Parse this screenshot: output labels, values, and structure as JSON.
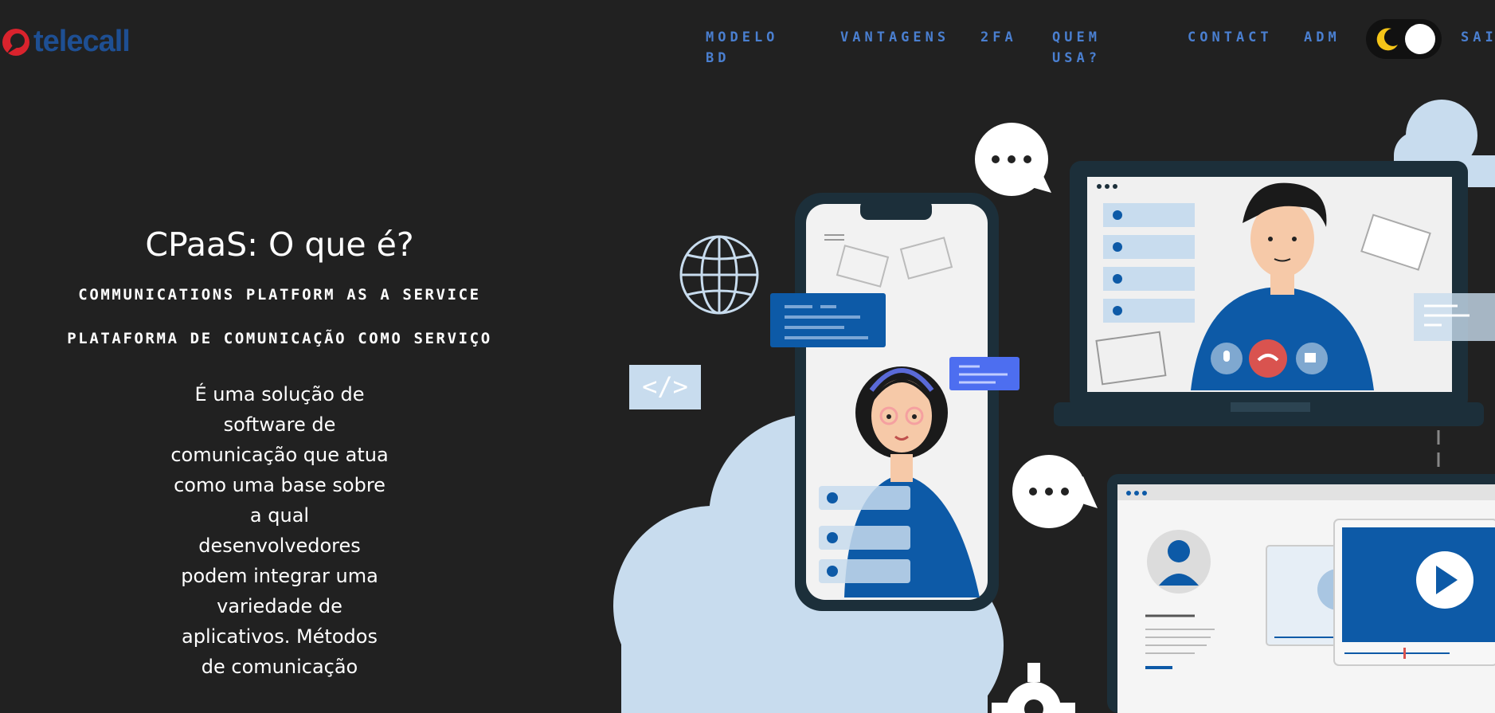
{
  "brand": {
    "logo_text": "telecall",
    "logo_mark": "telecall-logo-mark"
  },
  "nav": {
    "items": [
      {
        "label": "Modelo BD"
      },
      {
        "label": "Vantagens"
      },
      {
        "label": "2FA"
      },
      {
        "label": "Quem usa?"
      },
      {
        "label": "Contact"
      },
      {
        "label": "ADM"
      },
      {
        "label": "Sair"
      }
    ]
  },
  "theme_toggle": {
    "icon": "moon-icon",
    "state": "dark"
  },
  "hero": {
    "title": "CPaaS: O que é?",
    "subtitle_en": "Communications Platform as a Service",
    "subtitle_pt": "Plataforma de Comunicação como Serviço",
    "description": "É uma solução de software de comunicação que atua como uma base sobre a qual desenvolvedores podem integrar uma variedade de aplicativos. Métodos de comunicação"
  },
  "colors": {
    "background": "#212121",
    "nav_text": "#4a7fd0",
    "brand_blue": "#1e4f93",
    "brand_red": "#d9232d",
    "illustration_blue": "#0d5aa7",
    "cloud": "#c8dcee",
    "moon": "#f5c518"
  }
}
